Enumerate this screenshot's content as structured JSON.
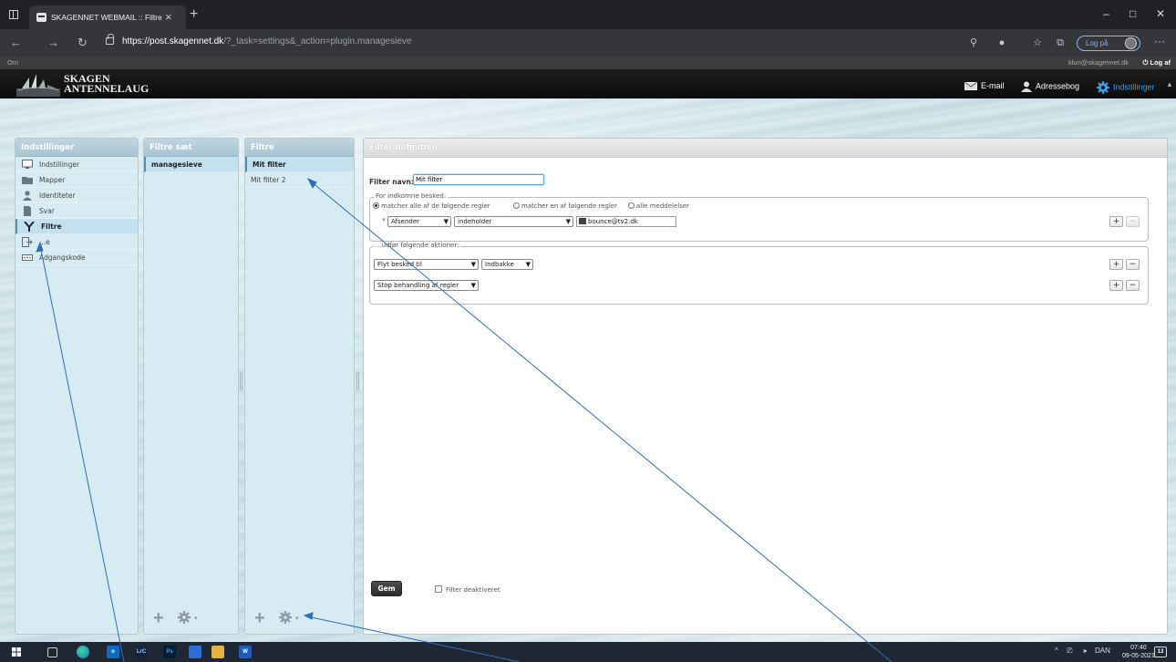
{
  "browser": {
    "tab_title": "SKAGENNET WEBMAIL :: Filtre",
    "tab_close": "×",
    "new_tab": "+",
    "url_host": "https://post.skagennet.dk",
    "url_path": "/?_task=settings&_action=plugin.managesieve",
    "login_label": "Log på",
    "more": "···",
    "window_controls": [
      "–",
      "□",
      "✕"
    ]
  },
  "app_top": {
    "about": "Om",
    "user": "klun@skagennet.dk",
    "logout": "Log af"
  },
  "logo": {
    "line1": "SKAGEN",
    "line2": "ANTENNELAUG"
  },
  "topnav": {
    "email": "E-mail",
    "addressbook": "Adressebog",
    "settings": "Indstillinger"
  },
  "settings_panel": {
    "title": "Indstillinger",
    "items": [
      {
        "label": "Indstillinger",
        "icon": "monitor-icon"
      },
      {
        "label": "Mapper",
        "icon": "folder-icon"
      },
      {
        "label": "Identiteter",
        "icon": "person-icon"
      },
      {
        "label": "Svar",
        "icon": "document-icon"
      },
      {
        "label": "Filtre",
        "icon": "filter-icon"
      },
      {
        "label": "...e",
        "icon": "export-icon"
      },
      {
        "label": "Adgangskode",
        "icon": "password-icon"
      }
    ]
  },
  "filtersets_panel": {
    "title": "Filtre sæt",
    "items": [
      "managesieve"
    ]
  },
  "filters_panel": {
    "title": "Filtre",
    "items": [
      "Mit filter",
      "Mit filter 2"
    ]
  },
  "definition": {
    "title": "Filter definition",
    "name_label": "Filter navn:",
    "name_value": "Mit filter",
    "incoming_legend": "For indkomne besked:",
    "radio_all": "matcher alle af de følgende regler",
    "radio_any": "matcher en af følgende regler",
    "radio_messages": "alle meddelelser",
    "rule_header": "Afsender",
    "rule_op": "indeholder",
    "rule_value": "bounce@tv2.dk",
    "actions_legend": "...udfør følgende aktioner:",
    "action1": "Flyt besked til",
    "action1_target": "Indbakke",
    "action2": "Stop behandling af regler",
    "plus": "+",
    "minus": "−",
    "save": "Gem",
    "disabled_label": "Filter deaktiveret"
  },
  "taskbar": {
    "apps": [
      "LrC",
      "Ps",
      "W"
    ],
    "lang": "DAN",
    "time": "07:40",
    "date": "09-05-2021",
    "notif": "13"
  }
}
